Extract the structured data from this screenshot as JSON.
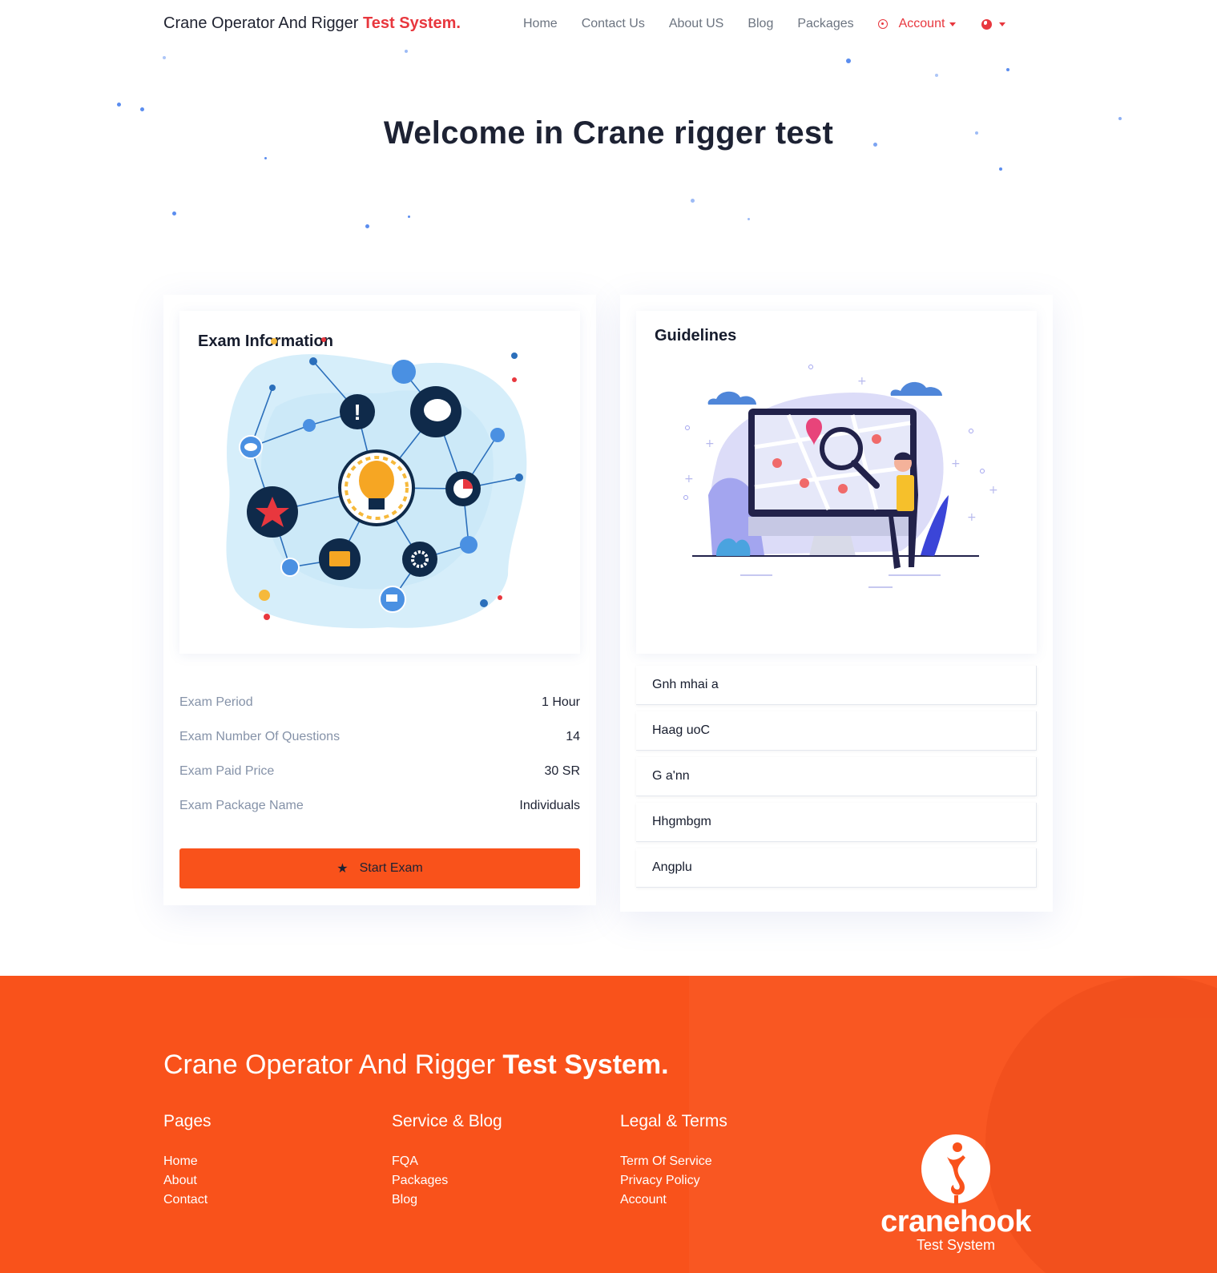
{
  "header": {
    "brand_prefix": "Crane Operator And Rigger",
    "brand_accent": "Test System.",
    "nav": [
      "Home",
      "Contact Us",
      "About US",
      "Blog",
      "Packages"
    ],
    "account_label": "Account"
  },
  "hero": {
    "title": "Welcome in Crane rigger test"
  },
  "exam": {
    "title": "Exam Information",
    "rows": [
      {
        "label": "Exam Period",
        "value": "1 Hour"
      },
      {
        "label": "Exam Number Of Questions",
        "value": "14"
      },
      {
        "label": "Exam Paid Price",
        "value": "30 SR"
      },
      {
        "label": "Exam Package Name",
        "value": "Individuals"
      }
    ],
    "start_label": "Start Exam"
  },
  "guidelines": {
    "title": "Guidelines",
    "items": [
      "Gnh mhai a",
      "Haag uoC",
      "G a'nn",
      "Hhgmbgm",
      "Angplu"
    ]
  },
  "footer": {
    "brand_prefix": "Crane Operator And Rigger",
    "brand_accent": "Test System.",
    "cols": [
      {
        "title": "Pages",
        "links": [
          "Home",
          "About",
          "Contact"
        ]
      },
      {
        "title": "Service & Blog",
        "links": [
          "FQA",
          "Packages",
          "Blog"
        ]
      },
      {
        "title": "Legal & Terms",
        "links": [
          "Term Of Service",
          "Privacy Policy",
          "Account"
        ]
      }
    ],
    "logo_word": "cranehook",
    "logo_sub": "Test System"
  },
  "colors": {
    "accent_red": "#e8373e",
    "footer_orange": "#f9521b",
    "dot_blue": "#5b8def"
  }
}
